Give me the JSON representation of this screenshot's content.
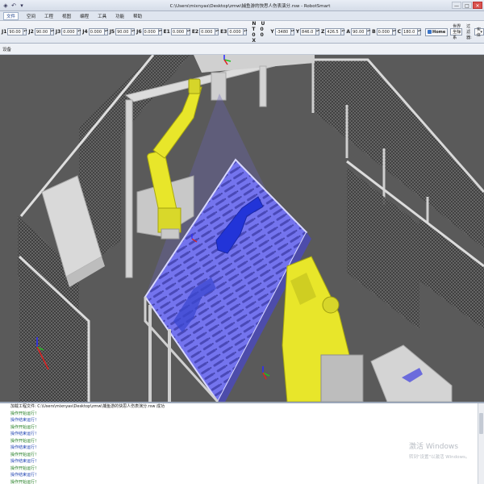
{
  "window": {
    "title": "C:\\Users\\mixnyas\\Desktop\\zmw\\捕鱼游的快思人伤表演分.rsw - RobotSmart",
    "minimize_label": "—",
    "maximize_label": "□",
    "close_label": "✕"
  },
  "menu": {
    "items": [
      "文件",
      "空间",
      "工程",
      "视图",
      "编程",
      "工具",
      "功能",
      "帮助"
    ],
    "active_index": 0
  },
  "toolbar": {
    "joints": [
      {
        "label": "J1",
        "value": "90.00"
      },
      {
        "label": "J2",
        "value": "90.00"
      },
      {
        "label": "J3",
        "value": "0.000"
      },
      {
        "label": "J4",
        "value": "0.000"
      },
      {
        "label": "J5",
        "value": "90.00"
      },
      {
        "label": "J6",
        "value": "0.000"
      },
      {
        "label": "E1",
        "value": "0.000"
      },
      {
        "label": "E2",
        "value": "0.000"
      },
      {
        "label": "E3",
        "value": "0.000"
      }
    ],
    "nut_label": "N U T 0 0 0 X",
    "coords": [
      {
        "label": "Y",
        "value": "-3480"
      },
      {
        "label": "Y",
        "value": "846.0"
      },
      {
        "label": "Z",
        "value": "426.5"
      },
      {
        "label": "A",
        "value": "90.00"
      },
      {
        "label": "B",
        "value": "0.000"
      },
      {
        "label": "C",
        "value": "180.0"
      }
    ],
    "home_label": "Home",
    "coord_system": "世界坐标系",
    "filter_label": "过滤器:",
    "filter_value": "实体"
  },
  "device_panel": {
    "label": "设备"
  },
  "output": {
    "lines": [
      "加载工程文件: C:\\Users\\mixnyas\\Desktop\\zmw\\捕鱼游的快思人伤表演分.rsw 成功",
      "操作开始运行！",
      "操作结束运行！",
      "操作开始运行！",
      "操作结束运行！",
      "操作开始运行！",
      "操作结束运行！",
      "操作开始运行！",
      "操作结束运行！",
      "操作开始运行！",
      "操作结束运行！",
      "操作开始运行！"
    ]
  },
  "watermark": {
    "title": "激活 Windows",
    "subtitle": "转到\"设置\"以激活 Windows。"
  },
  "colors": {
    "viewport_bg": "#575757",
    "robot_yellow": "#e8e62a",
    "fixture_blue": "#6e6ef0",
    "part_blue": "#2235d8",
    "floor_gray": "#8a8a8a"
  }
}
